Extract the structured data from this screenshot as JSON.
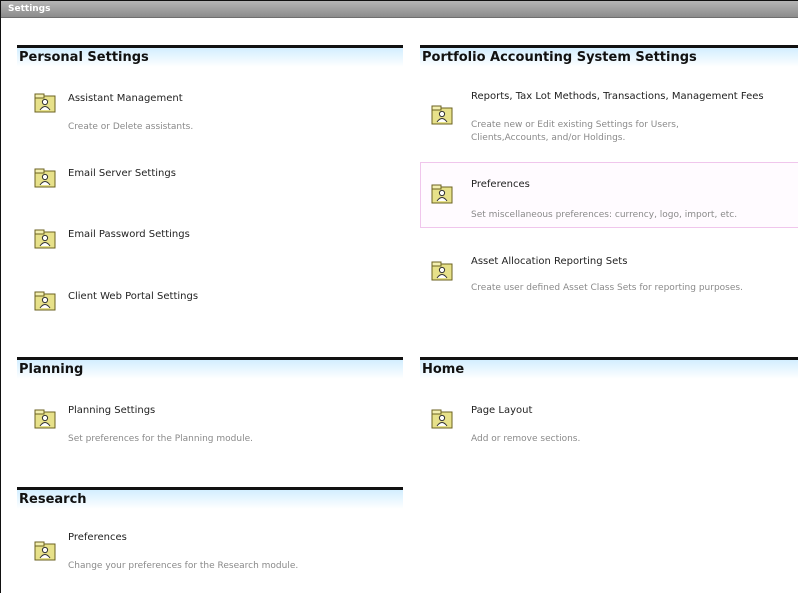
{
  "window": {
    "title": "Settings"
  },
  "sections": {
    "personal": {
      "title": "Personal Settings",
      "items": [
        {
          "title": "Assistant Management",
          "desc": "Create or Delete assistants."
        },
        {
          "title": "Email Server Settings",
          "desc": ""
        },
        {
          "title": "Email Password Settings",
          "desc": ""
        },
        {
          "title": "Client Web Portal Settings",
          "desc": ""
        }
      ]
    },
    "portfolio": {
      "title": "Portfolio Accounting System Settings",
      "items": [
        {
          "title": "Reports, Tax Lot Methods, Transactions, Management Fees",
          "desc1": "Create new or Edit existing Settings for Users,",
          "desc2": "Clients,Accounts, and/or Holdings."
        },
        {
          "title": "Preferences",
          "desc": "Set miscellaneous preferences: currency, logo, import, etc."
        },
        {
          "title": "Asset Allocation Reporting Sets",
          "desc": "Create user defined Asset Class Sets for reporting purposes."
        }
      ]
    },
    "planning": {
      "title": "Planning",
      "items": [
        {
          "title": "Planning Settings",
          "desc": "Set preferences for the Planning module."
        }
      ]
    },
    "home": {
      "title": "Home",
      "items": [
        {
          "title": "Page Layout",
          "desc": "Add or remove sections."
        }
      ]
    },
    "research": {
      "title": "Research",
      "items": [
        {
          "title": "Preferences",
          "desc": "Change your preferences for the Research module."
        }
      ]
    }
  }
}
